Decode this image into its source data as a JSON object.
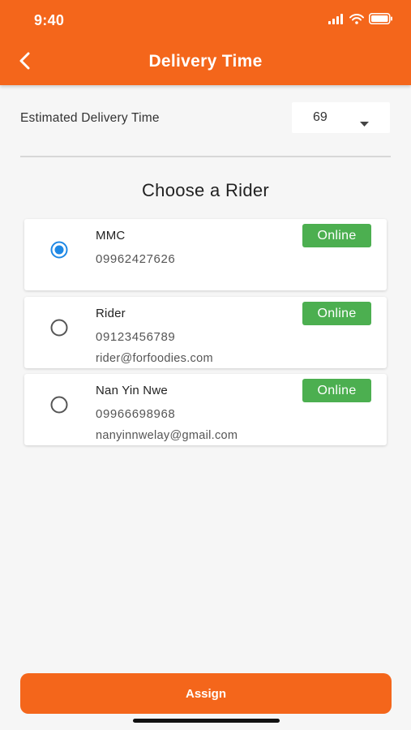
{
  "status_bar": {
    "time": "9:40"
  },
  "header": {
    "title": "Delivery Time"
  },
  "estimate": {
    "label": "Estimated Delivery Time",
    "value": "69"
  },
  "section_title": "Choose a Rider",
  "riders": [
    {
      "name": "MMC",
      "phone": "09962427626",
      "email": "",
      "status": "Online",
      "selected": true
    },
    {
      "name": "Rider",
      "phone": "09123456789",
      "email": "rider@forfoodies.com",
      "status": "Online",
      "selected": false
    },
    {
      "name": "Nan Yin Nwe",
      "phone": "09966698968",
      "email": "nanyinnwelay@gmail.com",
      "status": "Online",
      "selected": false
    }
  ],
  "assign_label": "Assign",
  "colors": {
    "primary": "#f4661b",
    "online": "#4caf50",
    "radio_selected": "#1e88e5",
    "background": "#f6f6f6"
  },
  "icons": {
    "back": "chevron-left-icon",
    "dropdown": "caret-down-icon",
    "signal": "signal-icon",
    "wifi": "wifi-icon",
    "battery": "battery-icon"
  }
}
